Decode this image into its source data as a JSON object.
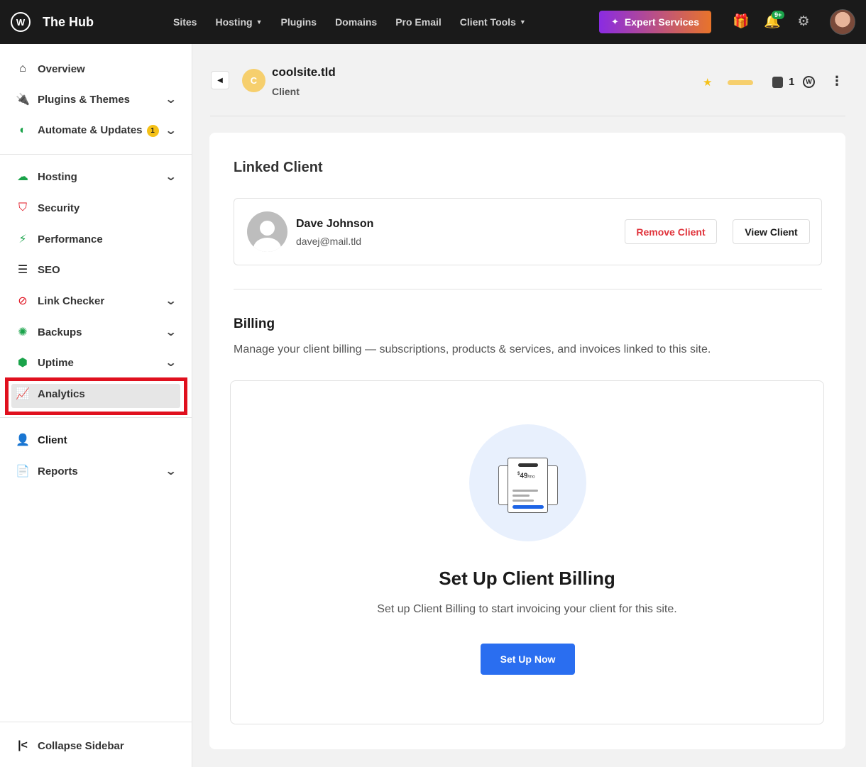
{
  "app": {
    "name": "The Hub"
  },
  "topnav": [
    {
      "label": "Sites",
      "dropdown": false
    },
    {
      "label": "Hosting",
      "dropdown": true
    },
    {
      "label": "Plugins",
      "dropdown": false
    },
    {
      "label": "Domains",
      "dropdown": false
    },
    {
      "label": "Pro Email",
      "dropdown": false
    },
    {
      "label": "Client Tools",
      "dropdown": true
    }
  ],
  "expert_button": {
    "label": "Expert Services"
  },
  "notifications": {
    "badge": "9+"
  },
  "sidebar": {
    "items": [
      {
        "label": "Overview",
        "icon": "home-icon",
        "dropdown": false
      },
      {
        "label": "Plugins & Themes",
        "icon": "plug-icon",
        "dropdown": true
      },
      {
        "label": "Automate & Updates",
        "icon": "automate-icon",
        "dropdown": true,
        "badge": "1"
      },
      {
        "label": "Hosting",
        "icon": "cloud-icon",
        "dropdown": true
      },
      {
        "label": "Security",
        "icon": "shield-icon",
        "dropdown": false
      },
      {
        "label": "Performance",
        "icon": "bolt-icon",
        "dropdown": false
      },
      {
        "label": "SEO",
        "icon": "seo-icon",
        "dropdown": false
      },
      {
        "label": "Link Checker",
        "icon": "link-icon",
        "dropdown": true
      },
      {
        "label": "Backups",
        "icon": "backup-icon",
        "dropdown": true
      },
      {
        "label": "Uptime",
        "icon": "uptime-icon",
        "dropdown": true
      },
      {
        "label": "Analytics",
        "icon": "chart-icon",
        "dropdown": false
      },
      {
        "label": "Client",
        "icon": "user-icon",
        "dropdown": false,
        "active": true
      },
      {
        "label": "Reports",
        "icon": "report-icon",
        "dropdown": true
      }
    ],
    "collapse_label": "Collapse Sidebar"
  },
  "site": {
    "name": "coolsite.tld",
    "initial": "C",
    "role": "Client",
    "pages_count": "1"
  },
  "linked_client": {
    "title": "Linked Client",
    "name": "Dave Johnson",
    "email": "davej@mail.tld",
    "remove_label": "Remove Client",
    "view_label": "View Client"
  },
  "billing": {
    "title": "Billing",
    "description": "Manage your client billing — subscriptions, products & services, and invoices linked to this site.",
    "illustration_price": "49",
    "illustration_currency": "$",
    "illustration_period": "/mo",
    "setup_title": "Set Up Client Billing",
    "setup_description": "Set up Client Billing to start invoicing your client for this site.",
    "setup_button": "Set Up Now"
  }
}
